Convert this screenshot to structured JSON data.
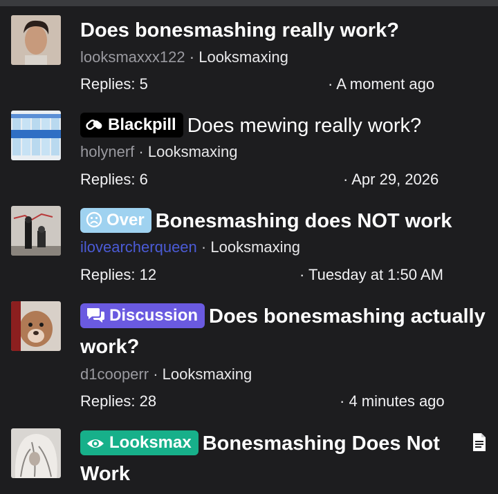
{
  "threads": [
    {
      "title": "Does bonesmashing really work?",
      "prefix": "",
      "user": "looksmaxxx122",
      "forum": "Looksmaxing",
      "replies": "Replies: 5",
      "time": "A moment ago",
      "avatar_icon": "user-avatar-dark-hair"
    },
    {
      "title": "Does mewing really work?",
      "prefix": "Blackpill",
      "prefix_icon": "pills-icon",
      "prefix_color": "#000000",
      "user": "holynerf",
      "forum": "Looksmaxing",
      "replies": "Replies: 6",
      "time": "Apr 29, 2026",
      "avatar_icon": "user-avatar-bottles"
    },
    {
      "title": "Bonesmashing does NOT work",
      "prefix": "Over",
      "prefix_icon": "sad-face-icon",
      "prefix_color": "#9fd2f0",
      "user": "ilovearcherqueen",
      "user_color": "#4b5bd6",
      "forum": "Looksmaxing",
      "replies": "Replies: 12",
      "time": "Tuesday at 1:50 AM",
      "avatar_icon": "user-avatar-graffiti"
    },
    {
      "title": "Does bonesmashing actually work?",
      "prefix": "Discussion",
      "prefix_icon": "chat-bubbles-icon",
      "prefix_color": "#6a5ae0",
      "user": "d1cooperr",
      "forum": "Looksmaxing",
      "replies": "Replies: 28",
      "time": "4 minutes ago",
      "avatar_icon": "user-avatar-dog"
    },
    {
      "title": "Bonesmashing Does Not Work",
      "prefix": "Looksmax",
      "prefix_icon": "eye-icon",
      "prefix_color": "#17b08a",
      "avatar_icon": "user-avatar-white-hair",
      "trailing_icon": "document-icon"
    }
  ],
  "separator": "·"
}
